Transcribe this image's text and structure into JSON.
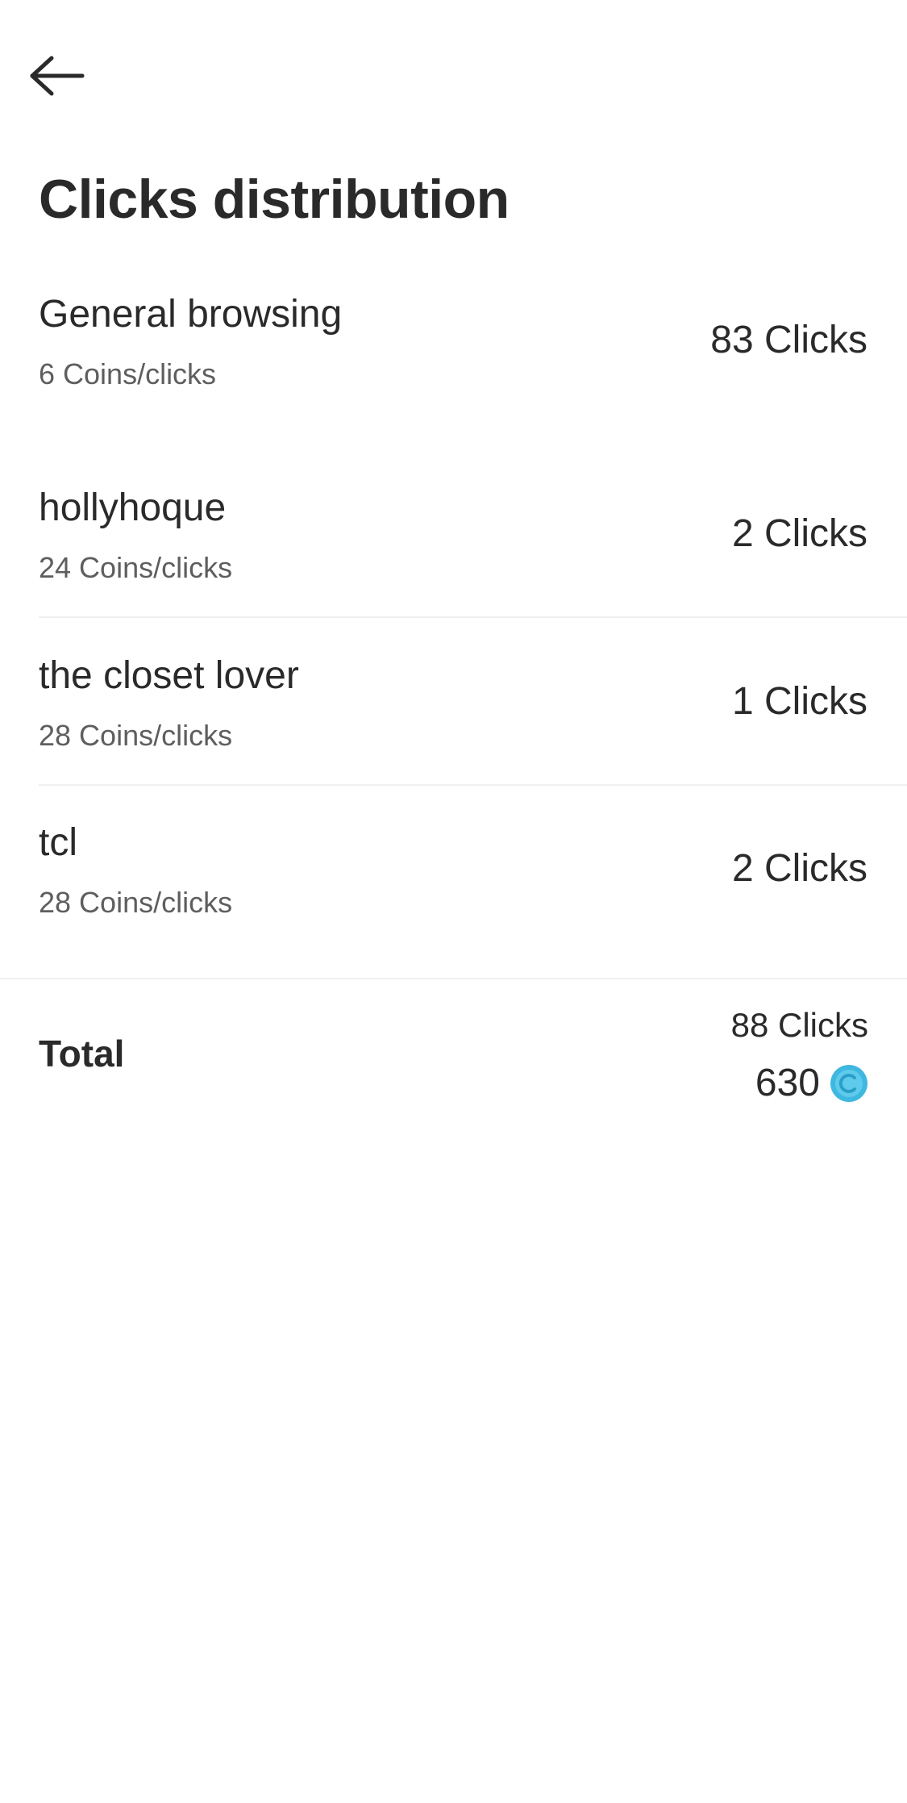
{
  "header": {
    "back_icon": "arrow-left-icon",
    "title": "Clicks distribution"
  },
  "rows": [
    {
      "name": "General browsing",
      "rate": "6 Coins/clicks",
      "clicks": "83 Clicks"
    },
    {
      "name": "hollyhoque",
      "rate": "24 Coins/clicks",
      "clicks": "2 Clicks"
    },
    {
      "name": "the closet lover",
      "rate": "28 Coins/clicks",
      "clicks": "1 Clicks"
    },
    {
      "name": "tcl",
      "rate": "28 Coins/clicks",
      "clicks": "2 Clicks"
    }
  ],
  "total": {
    "label": "Total",
    "clicks": "88 Clicks",
    "coins": "630",
    "coin_icon": "coin-icon"
  },
  "colors": {
    "text_primary": "#2a2a2a",
    "text_secondary": "#5e5e5e",
    "divider": "#f0f0f0",
    "coin": "#3fb8e0",
    "background": "#ffffff"
  }
}
